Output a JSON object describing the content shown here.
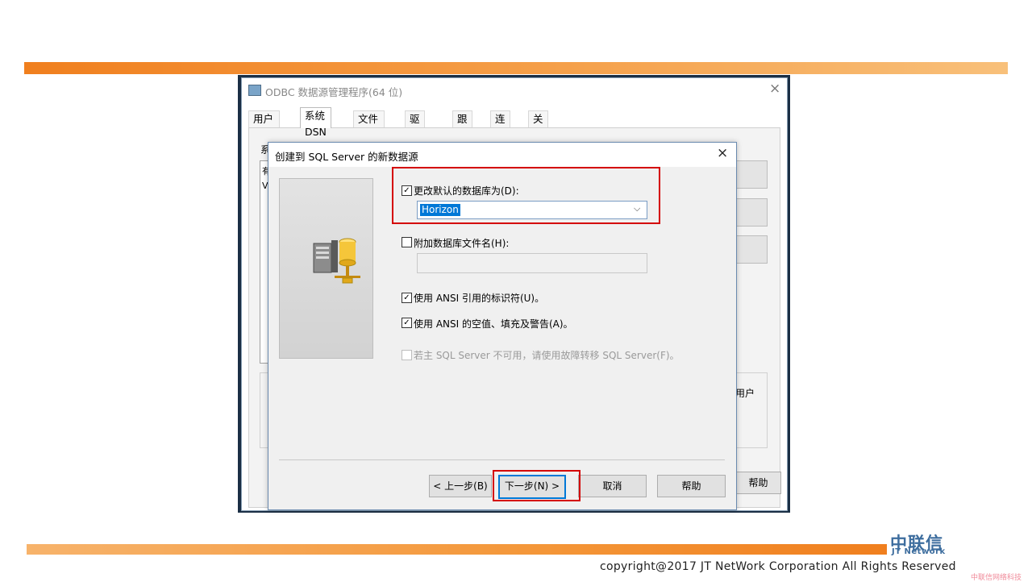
{
  "odbc_window": {
    "title": "ODBC 数据源管理程序(64 位)",
    "close_glyph": "×",
    "tabs": [
      {
        "label": "用户 DSN"
      },
      {
        "label": "系统 DSN"
      },
      {
        "label": "文件 DSN"
      },
      {
        "label": "驱动程序"
      },
      {
        "label": "跟踪"
      },
      {
        "label": "连接池"
      },
      {
        "label": "关于"
      }
    ],
    "active_tab": "系统 DSN",
    "panel_label_fragment": "系",
    "list_fragments": [
      "有",
      "V"
    ],
    "user_fragment": "用户",
    "help_label": "帮助"
  },
  "wizard": {
    "title": "创建到 SQL Server 的新数据源",
    "close_glyph": "×",
    "change_default_db": {
      "label": "更改默认的数据库为(D):",
      "checked": true
    },
    "default_db_value": "Horizon",
    "attach_db_file": {
      "label": "附加数据库文件名(H):",
      "checked": false
    },
    "attach_db_file_value": "",
    "ansi_quoted": {
      "label": "使用 ANSI 引用的标识符(U)。",
      "checked": true
    },
    "ansi_nulls": {
      "label": "使用 ANSI 的空值、填充及警告(A)。",
      "checked": true
    },
    "failover": {
      "label": "若主 SQL Server 不可用，请使用故障转移 SQL Server(F)。",
      "checked": false,
      "disabled": true
    },
    "buttons": {
      "back": "< 上一步(B)",
      "next": "下一步(N) >",
      "cancel": "取消",
      "help": "帮助"
    }
  },
  "slide": {
    "logo_cn": "中联信",
    "logo_en": "JT Network",
    "copyright": "copyright@2017  JT NetWork Corporation All Rights Reserved",
    "watermark": "中联信网络科技"
  },
  "colors": {
    "accent_orange": "#f07f1e",
    "highlight_red": "#d40000",
    "selection_blue": "#0078d7",
    "logo_blue": "#3d6d9e"
  }
}
